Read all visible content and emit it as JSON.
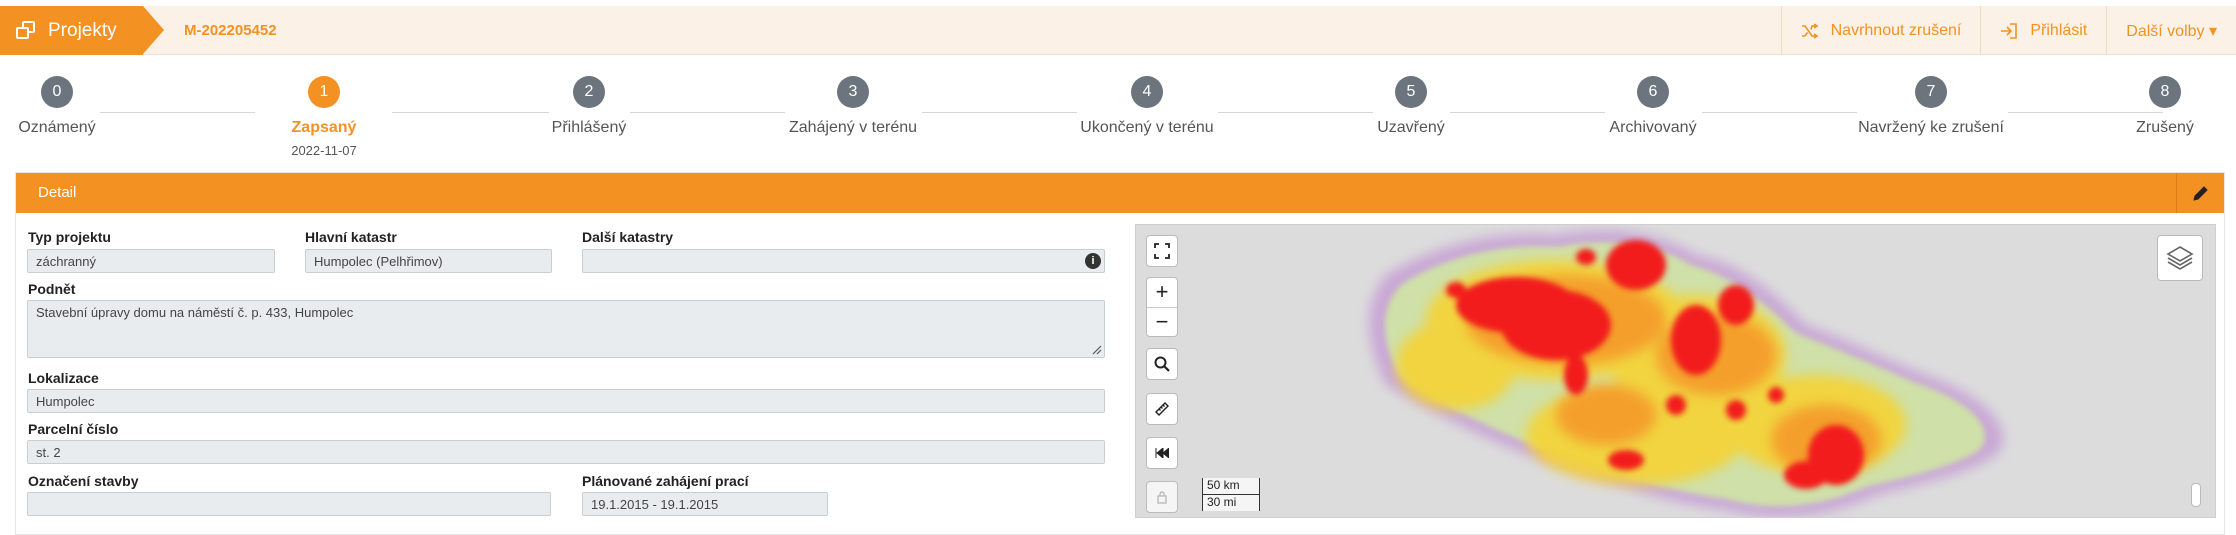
{
  "header": {
    "brand_label": "Projekty",
    "project_id": "M-202205452",
    "actions": [
      {
        "label": "Navrhnout zrušení",
        "icon": "shuffle-icon"
      },
      {
        "label": "Přihlásit",
        "icon": "sign-in-icon"
      },
      {
        "label": "Další volby ▾",
        "icon": ""
      }
    ]
  },
  "stepper": {
    "steps": [
      {
        "num": "0",
        "label": "Oznámený"
      },
      {
        "num": "1",
        "label": "Zapsaný",
        "date": "2022-11-07",
        "active": true
      },
      {
        "num": "2",
        "label": "Přihlášený"
      },
      {
        "num": "3",
        "label": "Zahájený v terénu"
      },
      {
        "num": "4",
        "label": "Ukončený v terénu"
      },
      {
        "num": "5",
        "label": "Uzavřený"
      },
      {
        "num": "6",
        "label": "Archivovaný"
      },
      {
        "num": "7",
        "label": "Navržený ke zrušení"
      },
      {
        "num": "8",
        "label": "Zrušený"
      }
    ]
  },
  "detail": {
    "title": "Detail",
    "typ_projektu": {
      "label": "Typ projektu",
      "value": "záchranný"
    },
    "hlavni_katastr": {
      "label": "Hlavní katastr",
      "value": "Humpolec (Pelhřimov)"
    },
    "dalsi_katastry": {
      "label": "Další katastry",
      "value": ""
    },
    "podnet": {
      "label": "Podnět",
      "value": "Stavební úpravy domu na náměstí č. p. 433, Humpolec"
    },
    "lokalizace": {
      "label": "Lokalizace",
      "value": "Humpolec"
    },
    "parcelni_cislo": {
      "label": "Parcelní číslo",
      "value": "st. 2"
    },
    "oznaceni_stavby": {
      "label": "Označení stavby",
      "value": ""
    },
    "planovane_zahajeni": {
      "label": "Plánované zahájení prací",
      "value": "19.1.2015 - 19.1.2015"
    }
  },
  "map": {
    "scale_km": "50 km",
    "scale_mi": "30 mi",
    "zoom_in": "+",
    "zoom_out": "−"
  },
  "colors": {
    "accent": "#f39223",
    "step_inactive": "#6c757d",
    "header_bg": "#fbf1e6"
  }
}
